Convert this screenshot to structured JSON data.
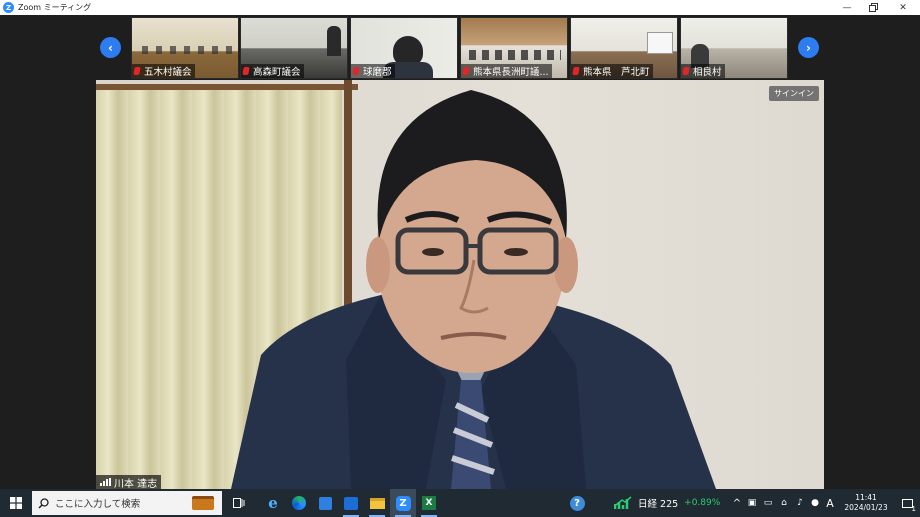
{
  "window": {
    "title": "Zoom ミーティング",
    "logo": "Z"
  },
  "thumbnails": [
    {
      "label": "五木村議会",
      "muted": true,
      "scene": "council-row"
    },
    {
      "label": "高森町議会",
      "muted": true,
      "scene": "council-room"
    },
    {
      "label": "球磨郡",
      "muted": true,
      "scene": "person-closeup"
    },
    {
      "label": "熊本県長洲町議...",
      "muted": true,
      "scene": "wood-hall"
    },
    {
      "label": "熊本県　芦北町",
      "muted": true,
      "scene": "bright-room"
    },
    {
      "label": "相良村",
      "muted": true,
      "scene": "meeting-table"
    }
  ],
  "main_video": {
    "participant_name": "川本 達志",
    "signin_label": "サインイン"
  },
  "taskbar": {
    "search_placeholder": "ここに入力して検索",
    "stock_label": "日経 225",
    "stock_change": "+0.89%",
    "ime_indicator": "A",
    "time": "11:41",
    "date": "2024/01/23",
    "notification_count": "1"
  },
  "colors": {
    "zoom_blue": "#2d8cff",
    "nav_blue": "#2d7cf0",
    "muted_red": "#e0262b",
    "stock_green": "#2ecc71",
    "taskbar_bg": "#1f2a33"
  }
}
